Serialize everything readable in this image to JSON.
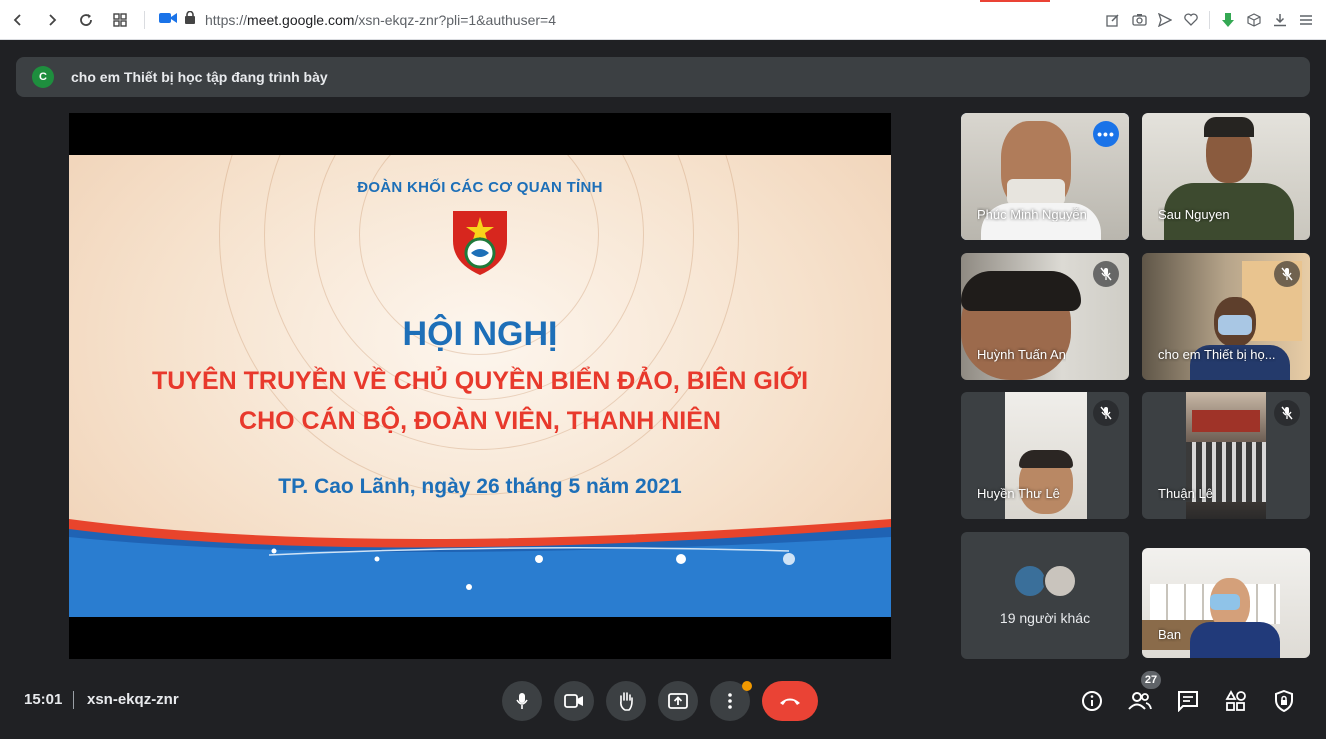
{
  "browser": {
    "url_prefix": "https://",
    "url_host": "meet.google.com",
    "url_path": "/xsn-ekqz-znr?pli=1&authuser=4"
  },
  "banner": {
    "avatar_letter": "C",
    "text": "cho em Thiết bị học tập đang trình bày"
  },
  "slide": {
    "org": "ĐOÀN KHỐI CÁC CƠ QUAN TỈNH",
    "title": "HỘI NGHỊ",
    "line1": "TUYÊN TRUYỀN VỀ CHỦ QUYỀN BIỂN ĐẢO, BIÊN GIỚI",
    "line2": "CHO CÁN BỘ, ĐOÀN VIÊN, THANH NIÊN",
    "date": "TP. Cao Lãnh, ngày 26 tháng 5 năm 2021"
  },
  "participants": [
    {
      "name": "Phúc Minh Nguyễn",
      "muted": false,
      "active": true
    },
    {
      "name": "Sau Nguyen",
      "muted": false,
      "active": false
    },
    {
      "name": "Huỳnh Tuấn An",
      "muted": true,
      "active": false
    },
    {
      "name": "cho em Thiết bị họ...",
      "muted": true,
      "active": false
    },
    {
      "name": "Huyền Thư Lê",
      "muted": true,
      "active": false
    },
    {
      "name": "Thuận Lê",
      "muted": true,
      "active": false
    },
    {
      "name": "Ban",
      "muted": false,
      "active": false
    }
  ],
  "others": {
    "label": "19 người khác"
  },
  "bottom": {
    "time": "15:01",
    "meeting_code": "xsn-ekqz-znr",
    "participant_count": "27"
  },
  "colors": {
    "accent_blue": "#8ab4f8",
    "end_call_red": "#ea4335",
    "slide_blue": "#1d6fb8",
    "slide_red": "#e8392c"
  },
  "icons": [
    "back-icon",
    "forward-icon",
    "reload-icon",
    "apps-icon",
    "camera-site-icon",
    "lock-icon",
    "edit-icon",
    "screenshot-icon",
    "send-icon",
    "heart-icon",
    "extension-icon",
    "cube-icon",
    "download-icon",
    "menu-icon",
    "mic-icon",
    "video-icon",
    "hand-icon",
    "present-icon",
    "more-icon",
    "end-call-icon",
    "info-icon",
    "people-icon",
    "chat-icon",
    "activities-icon",
    "host-controls-icon"
  ]
}
